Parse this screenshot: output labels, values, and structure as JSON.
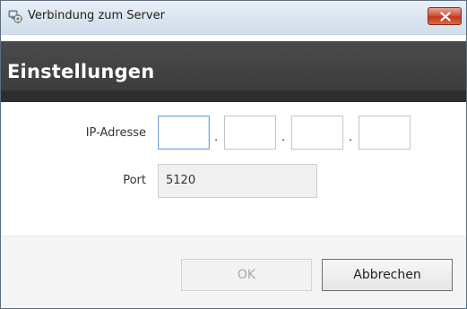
{
  "window": {
    "title": "Verbindung zum Server",
    "app_icon": "server-connection-icon",
    "close_icon": "close-icon",
    "close_color": "#c7421f"
  },
  "header": {
    "title": "Einstellungen",
    "background": "#3f3f3f"
  },
  "form": {
    "ip_label": "IP-Adresse",
    "ip_octets": [
      "",
      "",
      "",
      ""
    ],
    "ip_separator": ".",
    "port_label": "Port",
    "port_value": "5120"
  },
  "footer": {
    "ok_label": "OK",
    "ok_enabled": false,
    "cancel_label": "Abbrechen"
  }
}
